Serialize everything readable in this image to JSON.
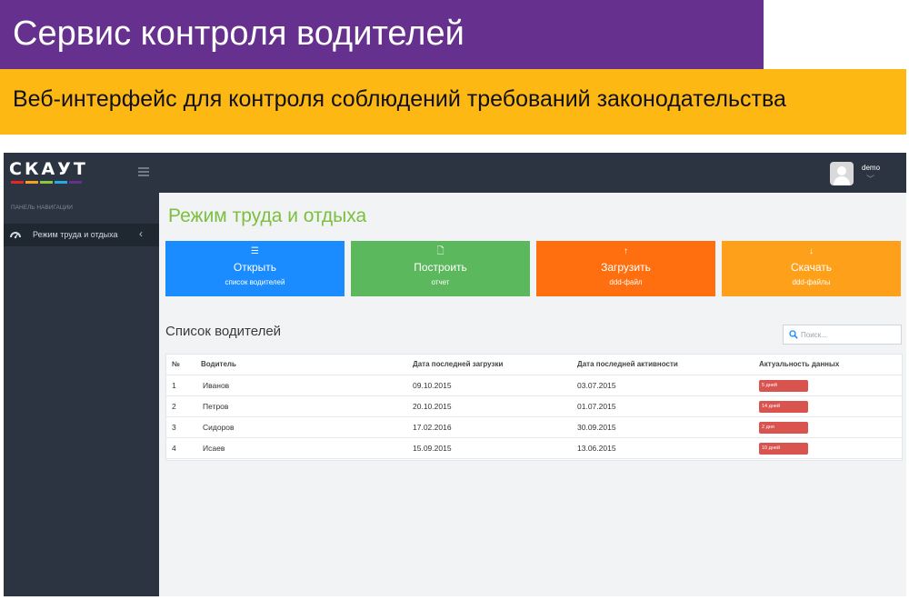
{
  "slide": {
    "title": "Сервис контроля водителей",
    "subtitle": "Веб-интерфейс для контроля соблюдений требований законодательства"
  },
  "app": {
    "logo_text": "СКАУТ",
    "logo_stripe_colors": [
      "#e5252a",
      "#f7a21b",
      "#8cc63f",
      "#27aae1",
      "#66308e"
    ],
    "user": {
      "name": "demo",
      "caret": "﹀"
    },
    "sidebar": {
      "caption": "Панель навигации",
      "items": [
        {
          "label": "Режим труда и отдыха",
          "icon": "gauge-icon",
          "chevron": "‹"
        }
      ]
    },
    "page_title": "Режим труда и отдыха",
    "tiles": [
      {
        "icon": "list-icon",
        "glyph": "☰",
        "title": "Открыть",
        "subtitle": "список водителей",
        "color": "#1a8cff"
      },
      {
        "icon": "document-icon",
        "glyph": "🗋",
        "title": "Построить",
        "subtitle": "отчет",
        "color": "#5cb85c"
      },
      {
        "icon": "upload-icon",
        "glyph": "↑",
        "title": "Загрузить",
        "subtitle": "ddd-файл",
        "color": "#ff6f0f"
      },
      {
        "icon": "download-icon",
        "glyph": "↓",
        "title": "Скачать",
        "subtitle": "ddd-файлы",
        "color": "#ffa01a"
      }
    ],
    "list": {
      "title": "Список водителей",
      "search_placeholder": "Поиск...",
      "columns": [
        "№",
        "Водитель",
        "Дата последней загрузки",
        "Дата последней активности",
        "Актуальность данных"
      ],
      "rows": [
        {
          "n": "1",
          "driver": "Иванов",
          "last_upload": "09.10.2015",
          "last_activity": "03.07.2015",
          "freshness": "5 дней"
        },
        {
          "n": "2",
          "driver": "Петров",
          "last_upload": "20.10.2015",
          "last_activity": "01.07.2015",
          "freshness": "14 дней"
        },
        {
          "n": "3",
          "driver": "Сидоров",
          "last_upload": "17.02.2016",
          "last_activity": "30.09.2015",
          "freshness": "2 дня"
        },
        {
          "n": "4",
          "driver": "Исаев",
          "last_upload": "15.09.2015",
          "last_activity": "13.06.2015",
          "freshness": "10 дней"
        }
      ],
      "badge_color": "#d9534f"
    }
  }
}
